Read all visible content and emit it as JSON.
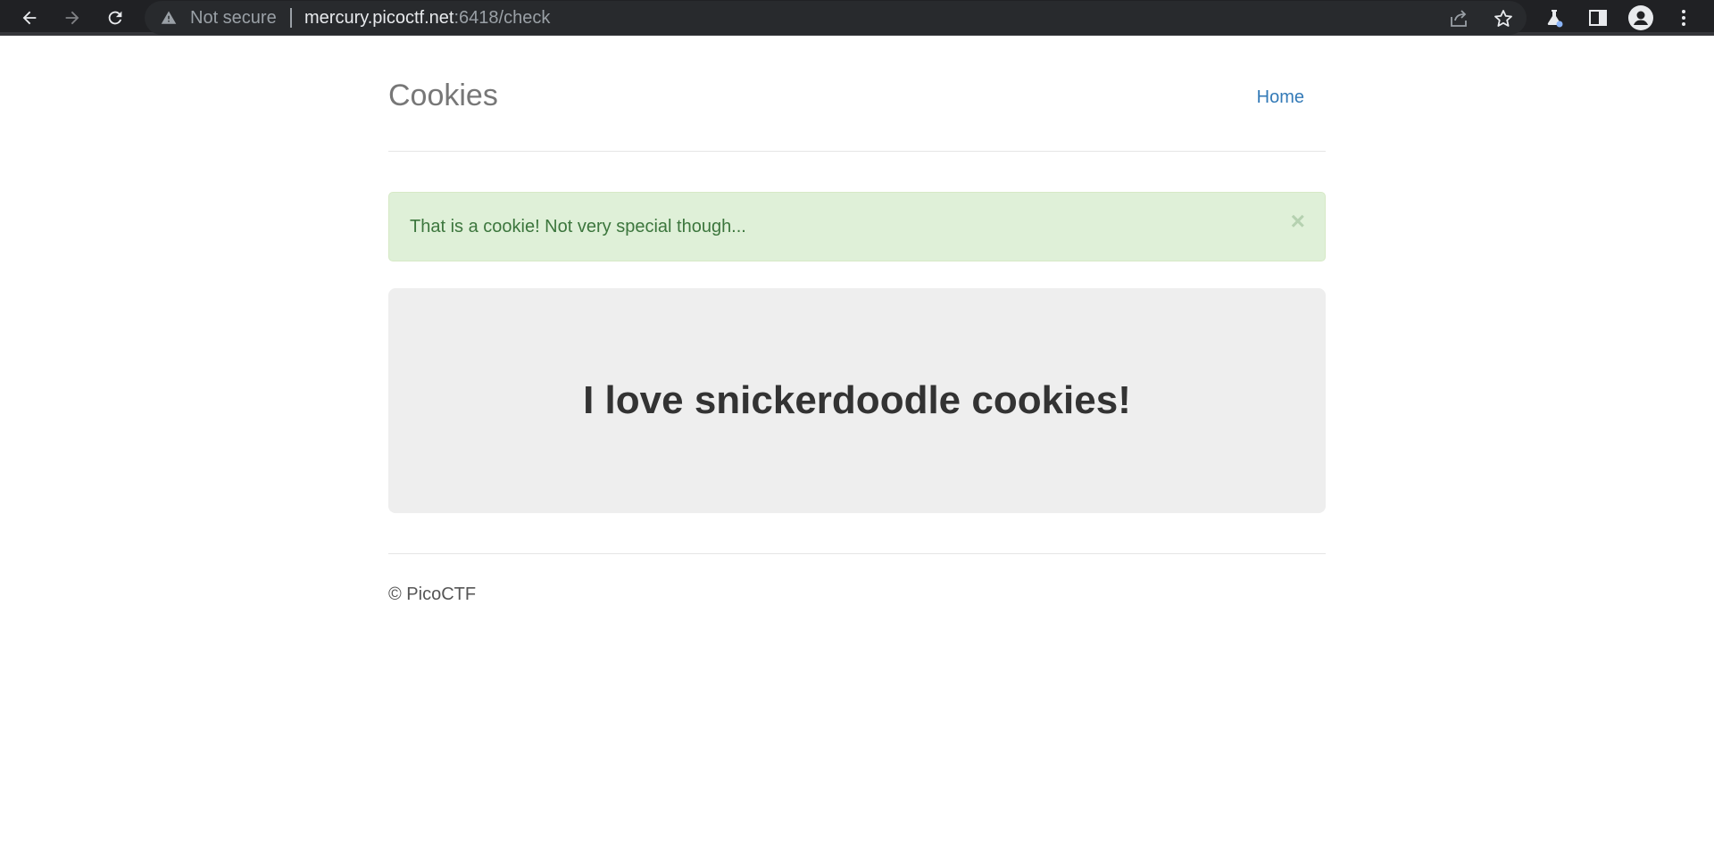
{
  "browser": {
    "security_label": "Not secure",
    "url_host": "mercury.picoctf.net",
    "url_rest": ":6418/check"
  },
  "page": {
    "brand": "Cookies",
    "nav": {
      "home": "Home"
    },
    "alert": {
      "message": "That is a cookie! Not very special though...",
      "close": "×"
    },
    "jumbotron": {
      "heading": "I love snickerdoodle cookies!"
    },
    "footer": {
      "copyright": "© PicoCTF"
    }
  },
  "colors": {
    "chrome_bg": "#202124",
    "omnibox_bg": "#282a2d",
    "link": "#337ab7",
    "alert_bg": "#dff0d8",
    "alert_text": "#3c763d",
    "jumbotron_bg": "#eeeeee"
  }
}
